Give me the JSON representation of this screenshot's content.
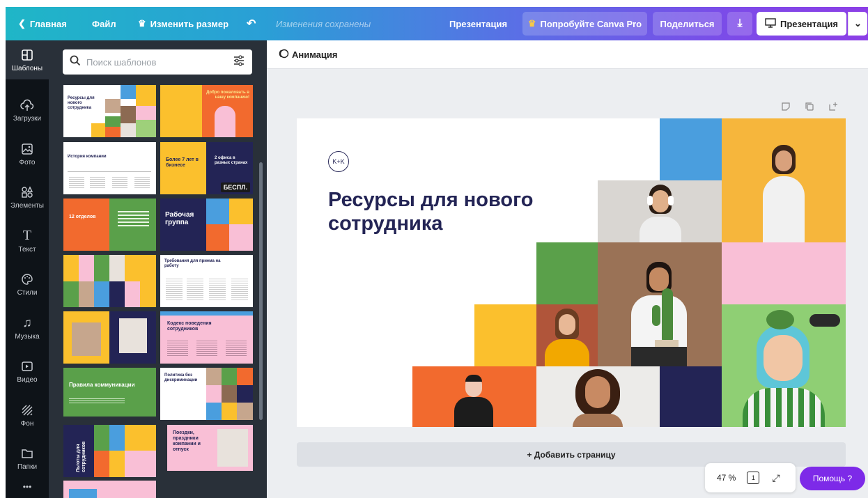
{
  "topbar": {
    "home": "Главная",
    "file": "Файл",
    "resize": "Изменить размер",
    "saved_status": "Изменения сохранены",
    "doc_type": "Презентация",
    "try_pro": "Попробуйте Canva Pro",
    "share": "Поделиться",
    "present": "Презентация"
  },
  "rail": {
    "items": [
      {
        "label": "Шаблоны",
        "icon": "templates-icon"
      },
      {
        "label": "Загрузки",
        "icon": "upload-cloud-icon"
      },
      {
        "label": "Фото",
        "icon": "photo-icon"
      },
      {
        "label": "Элементы",
        "icon": "elements-icon"
      },
      {
        "label": "Текст",
        "icon": "text-icon"
      },
      {
        "label": "Стили",
        "icon": "palette-icon"
      },
      {
        "label": "Музыка",
        "icon": "music-icon"
      },
      {
        "label": "Видео",
        "icon": "video-icon"
      },
      {
        "label": "Фон",
        "icon": "background-icon"
      },
      {
        "label": "Папки",
        "icon": "folder-icon"
      }
    ],
    "more": "•••"
  },
  "panel": {
    "search_placeholder": "Поиск шаблонов",
    "thumbnails": [
      {
        "title": "Ресурсы для нового сотрудника"
      },
      {
        "title": "Добро пожаловать в нашу компанию!"
      },
      {
        "title": "История компании"
      },
      {
        "title": "Более 7 лет в бизнесе"
      },
      {
        "title": "2 офиса в разных странах",
        "badge": "БЕСПЛ."
      },
      {
        "title": "12 отделов"
      },
      {
        "title": "Рабочая группа"
      },
      {
        "title": "Требования для приема на работу"
      },
      {
        "title": "Кодекс поведения сотрудников"
      },
      {
        "title": "Правила коммуникации"
      },
      {
        "title": "Политика без дискриминации"
      },
      {
        "title": "Льготы для сотрудников"
      },
      {
        "title": "Поездки, праздники компании и отпуск"
      }
    ]
  },
  "editor": {
    "animation": "Анимация",
    "add_page": "+ Добавить страницу",
    "zoom": "47 %",
    "page_number": "1",
    "help": "Помощь ?"
  },
  "slide": {
    "logo": "K+K",
    "title": "Ресурсы для нового сотрудника"
  },
  "colors": {
    "navy": "#232455",
    "orange": "#f26a2e",
    "yellow": "#fbc02d",
    "green": "#5aa04a",
    "pink": "#f9bfd6",
    "blue": "#4a9ede",
    "pro_purple": "#7d2ae8"
  }
}
